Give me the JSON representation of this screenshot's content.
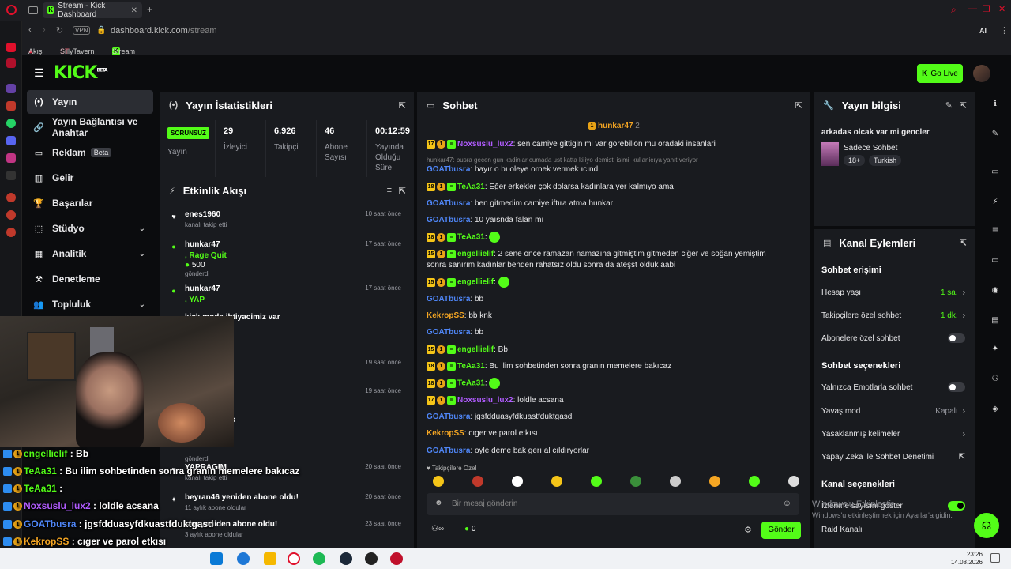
{
  "browser": {
    "tab_title": "Stream - Kick Dashboard",
    "url_host": "dashboard.kick.com",
    "url_path": "/stream",
    "vpn": "VPN",
    "ai": "AI",
    "bookmarks": [
      "Akış",
      "SillyTavern",
      "Stream - Kick Das..."
    ]
  },
  "header": {
    "logo": "KICK",
    "logo_sup": "BETA",
    "go_live": "Go Live"
  },
  "nav": [
    {
      "label": "Yayın",
      "icon": "(•)",
      "active": true
    },
    {
      "label": "Yayın Bağlantısı ve Anahtar",
      "icon": "🔗"
    },
    {
      "label": "Reklam",
      "icon": "▭",
      "beta": "Beta"
    },
    {
      "label": "Gelir",
      "icon": "▥"
    },
    {
      "label": "Başarılar",
      "icon": "🏆"
    },
    {
      "label": "Stüdyo",
      "icon": "⬚",
      "chevron": true
    },
    {
      "label": "Analitik",
      "icon": "▦",
      "chevron": true
    },
    {
      "label": "Denetleme",
      "icon": "⚒"
    },
    {
      "label": "Topluluk",
      "icon": "👥",
      "chevron": true
    }
  ],
  "stats": {
    "title": "Yayın İstatistikleri",
    "status": "SORUNSUZ",
    "status_label": "Yayın",
    "cells": [
      {
        "value": "29",
        "label": "İzleyici"
      },
      {
        "value": "6.926",
        "label": "Takipçi"
      },
      {
        "value": "46",
        "label": "Abone Sayısı"
      },
      {
        "value": "00:12:59",
        "label": "Yayında Olduğu Süre"
      }
    ]
  },
  "activity": {
    "title": "Etkinlik Akışı",
    "items": [
      {
        "name": "enes1960",
        "desc": "kanalı takip etti",
        "time": "10 saat önce"
      },
      {
        "name": "hunkar47",
        "extra": ", Rage Quit",
        "amount": "500",
        "desc": "gönderdi",
        "time": "17 saat önce"
      },
      {
        "name": "hunkar47",
        "extra": ", YAP",
        "time": "17 saat önce"
      },
      {
        "name": "kick moda ihtiyacimiz var"
      },
      {
        "name": "e",
        "time": "19 saat önce"
      },
      {
        "time": "19 saat önce"
      },
      {
        "name": "muzlu sutu ic"
      },
      {
        "desc": "gönderdi"
      },
      {
        "name": "YAPRAGIM",
        "desc": "kanalı takip etti",
        "time": "20 saat önce"
      },
      {
        "name": "beyran46 yeniden abone oldu!",
        "desc": "11 aylık abone oldular",
        "time": "20 saat önce"
      },
      {
        "name": "sko yeniden abone oldu!",
        "desc": "3 aylık abone oldular",
        "time": "23 saat önce"
      }
    ]
  },
  "chat": {
    "title": "Sohbet",
    "pinned_user": "hunkar47",
    "pinned_count": "2",
    "messages": [
      {
        "badges": [
          "17"
        ],
        "user": "Noxsuslu_lux2",
        "color": "pur",
        "text": ": sen camiye gittigin mi var gorebilion mu oradaki insanlari"
      },
      {
        "reply": "hunkar47: busra gecen gun kadinlar cumada ust katta kiliyo demisti isimil kullanicıya yanıt veriyor"
      },
      {
        "user": "GOATbusra",
        "color": "blu",
        "text": ": hayır o bı oleye ornek vermek ıcındı"
      },
      {
        "badges": [
          "18"
        ],
        "user": "TeAa31",
        "color": "grn",
        "text": ": Eğer erkekler çok dolarsa kadınlara yer kalmıyo ama"
      },
      {
        "user": "GOATbusra",
        "color": "blu",
        "text": ": ben gitmedim camiye iftıra atma hunkar"
      },
      {
        "user": "GOATbusra",
        "color": "blu",
        "text": ": 10 yaısnda falan mı"
      },
      {
        "badges": [
          "18"
        ],
        "user": "TeAa31",
        "color": "grn",
        "text": ":"
      },
      {
        "badges": [
          "15"
        ],
        "user": "engellielif",
        "color": "grn",
        "text": ": 2 sene önce ramazan namazına gitmiştim gitmeden ciğer ve soğan yemiştim"
      },
      {
        "text": "sonra sanırım kadınlar benden rahatsız oldu sonra da ateşst olduk aabi"
      },
      {
        "badges": [
          "15"
        ],
        "user": "engellielif",
        "color": "grn",
        "text": ":"
      },
      {
        "user": "GOATbusra",
        "color": "blu",
        "text": ": bb"
      },
      {
        "user": "KekropSS",
        "color": "org",
        "text": ": bb knk"
      },
      {
        "user": "GOATbusra",
        "color": "blu",
        "text": ": bb"
      },
      {
        "badges": [
          "15"
        ],
        "user": "engellielif",
        "color": "grn",
        "text": ": Bb"
      },
      {
        "badges": [
          "18"
        ],
        "user": "TeAa31",
        "color": "grn",
        "text": ": Bu ilim sohbetinden sonra granın memelere bakıcaz"
      },
      {
        "badges": [
          "18"
        ],
        "user": "TeAa31",
        "color": "grn",
        "text": ":"
      },
      {
        "badges": [
          "17"
        ],
        "user": "Noxsuslu_lux2",
        "color": "pur",
        "text": ": loldle acsana"
      },
      {
        "user": "GOATbusra",
        "color": "blu",
        "text": ": jgsfdduasyfdkuastfduktgasd"
      },
      {
        "user": "KekropSS",
        "color": "org",
        "text": ": cıger ve parol etkısı"
      },
      {
        "user": "GOATbusra",
        "color": "blu",
        "text": ": oyle deme bak gerı al cıldıryorlar"
      }
    ],
    "followers_only": "Takipçilere Özel",
    "input_placeholder": "Bir mesaj gönderin",
    "count": "0",
    "send": "Gönder"
  },
  "stream_info": {
    "title": "Yayın bilgisi",
    "stream_title": "arkadas olcak var mi gencler",
    "category": "Sadece Sohbet",
    "tags": [
      "18+",
      "Turkish"
    ]
  },
  "channel_actions": {
    "title": "Kanal Eylemleri",
    "chat_access": "Sohbet erişimi",
    "account_age": "Hesap yaşı",
    "account_age_val": "1 sa.",
    "followers_chat": "Takipçilere özel sohbet",
    "followers_chat_val": "1 dk.",
    "subs_chat": "Abonelere özel sohbet",
    "chat_options": "Sohbet seçenekleri",
    "emotes_only": "Yalnızca Emotlarla sohbet",
    "slow_mode": "Yavaş mod",
    "slow_mode_val": "Kapalı",
    "banned_words": "Yasaklanmış kelimeler",
    "ai_moderation": "Yapay Zeka ile Sohbet Denetimi",
    "channel_options": "Kanal seçenekleri",
    "show_viewers": "İzlenme sayısını göster",
    "raid": "Raid Kanalı"
  },
  "overlay": [
    {
      "user": "engellielif",
      "text": " : Bb",
      "color": "#53fc18"
    },
    {
      "user": "TeAa31",
      "text": " : Bu ilim sohbetinden sonra granın memelere bakıcaz",
      "color": "#53fc18"
    },
    {
      "user": "TeAa31",
      "text": " :",
      "color": "#53fc18"
    },
    {
      "user": "Noxsuslu_lux2",
      "text": " : loldle acsana",
      "color": "#b15cff"
    },
    {
      "user": "GOATbusra",
      "text": " : jgsfdduasyfdkuastfduktgasd",
      "color": "#4f86f7"
    },
    {
      "user": "KekropSS",
      "text": " : cıger ve parol etkısı",
      "color": "#f5a623"
    },
    {
      "user": "GOATbusra",
      "text": " : oyle deme bak gerı al cıldıryorlar",
      "color": "#4f86f7"
    }
  ],
  "watermark": {
    "line1": "Windows'u Etkinleştir",
    "line2": "Windows'u etkinleştirmek için Ayarlar'a gidin."
  },
  "clock": {
    "time": "23:26",
    "date": "14.08.2026"
  }
}
